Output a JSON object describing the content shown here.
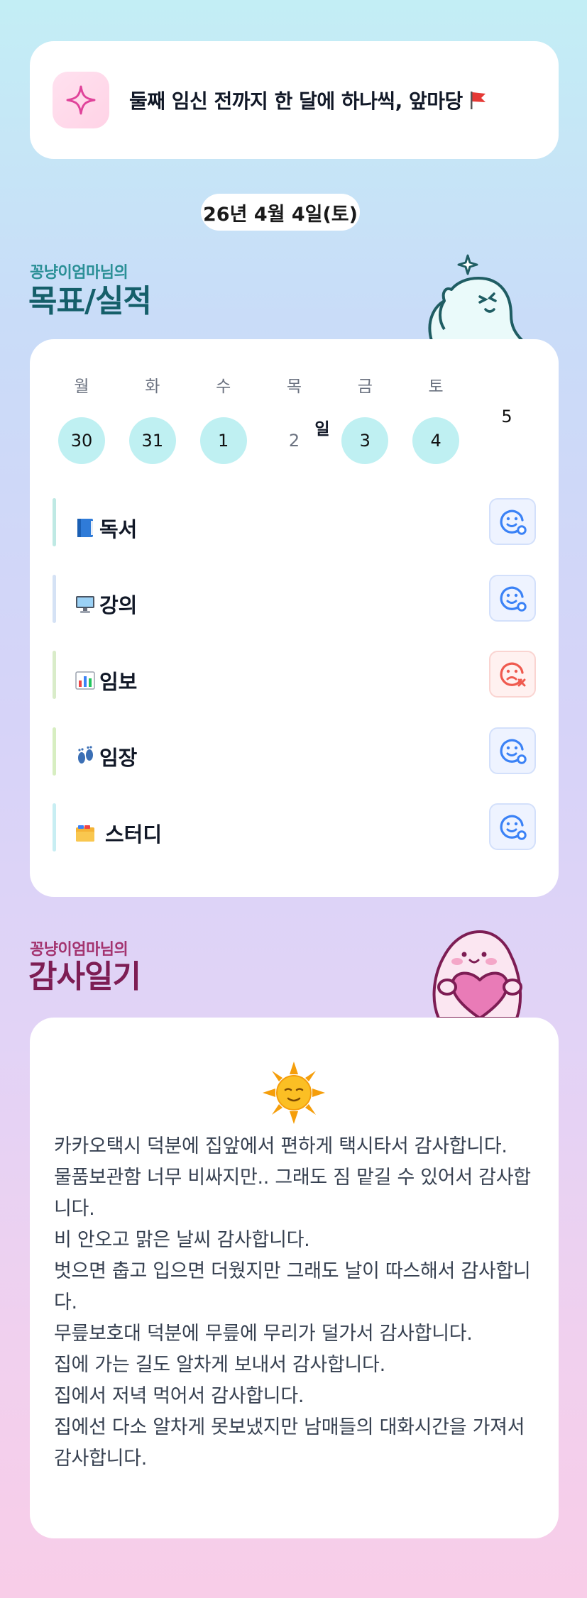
{
  "goal": {
    "icon": "sparkle-icon",
    "text": "둘째 임신 전까지 한 달에 하나씩, 앞마당",
    "flag_icon": "red-flag-icon"
  },
  "date_label": "26년 4월 4일(토)",
  "goals_section": {
    "subtitle": "꽁냥이엄마님의",
    "title": "목표/실적"
  },
  "calendar": {
    "days": [
      {
        "dow": "월",
        "date": "30",
        "status": "done"
      },
      {
        "dow": "화",
        "date": "31",
        "status": "done"
      },
      {
        "dow": "수",
        "date": "1",
        "status": "done"
      },
      {
        "dow": "목",
        "date": "2",
        "status": "none"
      },
      {
        "dow": "금",
        "date": "3",
        "status": "done"
      },
      {
        "dow": "토",
        "date": "4",
        "status": "done"
      },
      {
        "dow": "일",
        "date": "5",
        "status": "plain"
      }
    ]
  },
  "tasks": [
    {
      "icon": "blue-book-icon",
      "label": "독서",
      "status": "done",
      "bar_color": "#bfe9e4"
    },
    {
      "icon": "computer-monitor-icon",
      "label": "강의",
      "status": "done",
      "bar_color": "#d5e2f5"
    },
    {
      "icon": "bar-chart-icon",
      "label": "임보",
      "status": "missed",
      "bar_color": "#d9ecc9"
    },
    {
      "icon": "footprints-icon",
      "label": "임장",
      "status": "done",
      "bar_color": "#d7eec1"
    },
    {
      "icon": "card-index-dividers-icon",
      "label": "스터디",
      "status": "done",
      "bar_color": "#c8eef3"
    }
  ],
  "colors": {
    "done_icon": "#3b82f6",
    "missed_icon": "#ef5a4f",
    "done_circle": "#bff0f2"
  },
  "gratitude_section": {
    "subtitle": "꽁냥이엄마님의",
    "title": "감사일기"
  },
  "diary": {
    "icon": "sun-with-face-icon",
    "lines": [
      "카카오택시 덕분에 집앞에서 편하게 택시타서 감사합니다.",
      "물품보관함 너무 비싸지만.. 그래도 짐 맡길 수 있어서 감사합니다.",
      "비 안오고 맑은 날씨 감사합니다.",
      "벗으면 춥고 입으면 더웠지만 그래도 날이 따스해서 감사합니다.",
      "무릎보호대 덕분에 무릎에 무리가 덜가서 감사합니다.",
      "집에 가는 길도 알차게 보내서 감사합니다.",
      "집에서 저녁 먹어서 감사합니다.",
      "집에선 다소 알차게 못보냈지만 남매들의 대화시간을 가져서 감사합니다."
    ]
  }
}
